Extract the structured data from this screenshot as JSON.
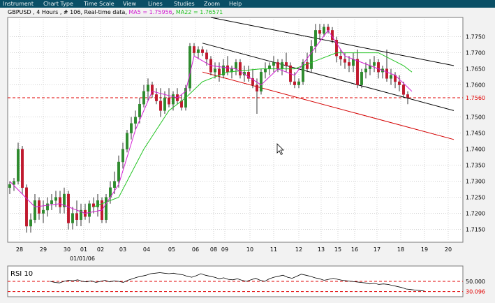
{
  "menu": [
    "Instrument",
    "Chart Type",
    "Time Scale",
    "View",
    "Lines",
    "Studies",
    "Zoom",
    "Help"
  ],
  "header": {
    "symbol_info": "GBPUSD , 4 Hours , # 106, Real-time data",
    "ma5_label": "MA5 = 1.75956",
    "ma22_label": "MA22 = 1.76571"
  },
  "colors": {
    "up_candle": "#2e8b2e",
    "down_candle": "#c0192e",
    "ma5": "#d21ed2",
    "ma22": "#22c322",
    "trend_channel": "#000000",
    "trend_red": "#d40000",
    "current_price_line": "#e10000",
    "rsi_line": "#000000",
    "rsi_level": "#e10000"
  },
  "chart_data": {
    "type": "candlestick",
    "title": "GBPUSD , 4 Hours , # 106, Real-time data",
    "y_range": [
      1.711,
      1.781
    ],
    "y_ticks": [
      "1.7750",
      "1.7700",
      "1.7650",
      "1.7600",
      "1.7500",
      "1.7450",
      "1.7400",
      "1.7350",
      "1.7300",
      "1.7250",
      "1.7200",
      "1.7150"
    ],
    "current_price": "1.7560",
    "x_ticks": [
      "28",
      "29",
      "30",
      "01",
      "02",
      "03",
      "04",
      "05",
      "06",
      "08",
      "09",
      "10",
      "11",
      "12",
      "13",
      "15",
      "16",
      "17",
      "18",
      "19",
      "20"
    ],
    "x_sublabel": "01/01/06",
    "candles": [
      [
        1.728,
        1.73,
        1.726,
        1.729
      ],
      [
        1.729,
        1.731,
        1.727,
        1.73
      ],
      [
        1.73,
        1.742,
        1.729,
        1.74
      ],
      [
        1.74,
        1.741,
        1.726,
        1.728
      ],
      [
        1.728,
        1.729,
        1.714,
        1.716
      ],
      [
        1.716,
        1.72,
        1.714,
        1.718
      ],
      [
        1.718,
        1.726,
        1.717,
        1.724
      ],
      [
        1.724,
        1.725,
        1.718,
        1.72
      ],
      [
        1.72,
        1.724,
        1.717,
        1.721
      ],
      [
        1.721,
        1.725,
        1.719,
        1.723
      ],
      [
        1.723,
        1.726,
        1.721,
        1.724
      ],
      [
        1.724,
        1.727,
        1.722,
        1.725
      ],
      [
        1.725,
        1.727,
        1.72,
        1.722
      ],
      [
        1.722,
        1.728,
        1.72,
        1.726
      ],
      [
        1.726,
        1.727,
        1.715,
        1.717
      ],
      [
        1.717,
        1.722,
        1.715,
        1.72
      ],
      [
        1.72,
        1.724,
        1.716,
        1.718
      ],
      [
        1.718,
        1.723,
        1.716,
        1.721
      ],
      [
        1.721,
        1.723,
        1.718,
        1.719
      ],
      [
        1.719,
        1.724,
        1.717,
        1.723
      ],
      [
        1.723,
        1.725,
        1.72,
        1.722
      ],
      [
        1.722,
        1.726,
        1.719,
        1.724
      ],
      [
        1.724,
        1.725,
        1.717,
        1.718
      ],
      [
        1.718,
        1.726,
        1.717,
        1.725
      ],
      [
        1.725,
        1.73,
        1.723,
        1.728
      ],
      [
        1.728,
        1.733,
        1.726,
        1.73
      ],
      [
        1.73,
        1.738,
        1.728,
        1.736
      ],
      [
        1.736,
        1.742,
        1.734,
        1.74
      ],
      [
        1.74,
        1.746,
        1.739,
        1.745
      ],
      [
        1.745,
        1.75,
        1.743,
        1.748
      ],
      [
        1.748,
        1.752,
        1.746,
        1.75
      ],
      [
        1.75,
        1.756,
        1.748,
        1.754
      ],
      [
        1.754,
        1.76,
        1.753,
        1.758
      ],
      [
        1.758,
        1.762,
        1.755,
        1.76
      ],
      [
        1.76,
        1.761,
        1.756,
        1.757
      ],
      [
        1.757,
        1.759,
        1.754,
        1.755
      ],
      [
        1.755,
        1.759,
        1.75,
        1.752
      ],
      [
        1.752,
        1.758,
        1.751,
        1.756
      ],
      [
        1.756,
        1.759,
        1.753,
        1.754
      ],
      [
        1.754,
        1.758,
        1.752,
        1.757
      ],
      [
        1.757,
        1.759,
        1.754,
        1.755
      ],
      [
        1.755,
        1.757,
        1.752,
        1.753
      ],
      [
        1.753,
        1.76,
        1.752,
        1.759
      ],
      [
        1.759,
        1.773,
        1.758,
        1.772
      ],
      [
        1.772,
        1.773,
        1.769,
        1.77
      ],
      [
        1.77,
        1.772,
        1.768,
        1.771
      ],
      [
        1.771,
        1.772,
        1.769,
        1.77
      ],
      [
        1.77,
        1.771,
        1.766,
        1.768
      ],
      [
        1.768,
        1.769,
        1.763,
        1.764
      ],
      [
        1.764,
        1.767,
        1.762,
        1.765
      ],
      [
        1.765,
        1.767,
        1.761,
        1.763
      ],
      [
        1.763,
        1.768,
        1.762,
        1.766
      ],
      [
        1.766,
        1.769,
        1.763,
        1.764
      ],
      [
        1.764,
        1.766,
        1.762,
        1.765
      ],
      [
        1.765,
        1.768,
        1.763,
        1.767
      ],
      [
        1.767,
        1.768,
        1.762,
        1.763
      ],
      [
        1.763,
        1.766,
        1.761,
        1.764
      ],
      [
        1.764,
        1.766,
        1.761,
        1.762
      ],
      [
        1.762,
        1.765,
        1.759,
        1.76
      ],
      [
        1.76,
        1.762,
        1.751,
        1.758
      ],
      [
        1.758,
        1.765,
        1.757,
        1.764
      ],
      [
        1.764,
        1.767,
        1.762,
        1.765
      ],
      [
        1.765,
        1.767,
        1.763,
        1.766
      ],
      [
        1.766,
        1.769,
        1.764,
        1.767
      ],
      [
        1.767,
        1.768,
        1.764,
        1.765
      ],
      [
        1.765,
        1.768,
        1.763,
        1.767
      ],
      [
        1.767,
        1.77,
        1.764,
        1.766
      ],
      [
        1.766,
        1.767,
        1.76,
        1.761
      ],
      [
        1.761,
        1.764,
        1.759,
        1.76
      ],
      [
        1.76,
        1.762,
        1.759,
        1.761
      ],
      [
        1.761,
        1.768,
        1.76,
        1.767
      ],
      [
        1.767,
        1.77,
        1.764,
        1.765
      ],
      [
        1.765,
        1.774,
        1.764,
        1.772
      ],
      [
        1.772,
        1.779,
        1.77,
        1.777
      ],
      [
        1.777,
        1.779,
        1.774,
        1.776
      ],
      [
        1.776,
        1.779,
        1.775,
        1.778
      ],
      [
        1.778,
        1.779,
        1.776,
        1.777
      ],
      [
        1.777,
        1.778,
        1.773,
        1.774
      ],
      [
        1.774,
        1.775,
        1.767,
        1.769
      ],
      [
        1.769,
        1.771,
        1.766,
        1.768
      ],
      [
        1.768,
        1.77,
        1.765,
        1.767
      ],
      [
        1.767,
        1.769,
        1.764,
        1.766
      ],
      [
        1.766,
        1.77,
        1.764,
        1.768
      ],
      [
        1.768,
        1.771,
        1.759,
        1.76
      ],
      [
        1.76,
        1.765,
        1.759,
        1.764
      ],
      [
        1.764,
        1.767,
        1.762,
        1.765
      ],
      [
        1.765,
        1.768,
        1.763,
        1.766
      ],
      [
        1.766,
        1.769,
        1.764,
        1.767
      ],
      [
        1.767,
        1.768,
        1.762,
        1.764
      ],
      [
        1.764,
        1.766,
        1.762,
        1.765
      ],
      [
        1.765,
        1.771,
        1.761,
        1.762
      ],
      [
        1.762,
        1.765,
        1.76,
        1.763
      ],
      [
        1.763,
        1.764,
        1.759,
        1.761
      ],
      [
        1.761,
        1.763,
        1.758,
        1.76
      ],
      [
        1.76,
        1.761,
        1.756,
        1.757
      ],
      [
        1.757,
        1.758,
        1.754,
        1.756
      ]
    ],
    "ma5": [
      [
        0,
        1.73
      ],
      [
        6,
        1.722
      ],
      [
        12,
        1.723
      ],
      [
        18,
        1.72
      ],
      [
        22,
        1.721
      ],
      [
        26,
        1.729
      ],
      [
        30,
        1.746
      ],
      [
        34,
        1.758
      ],
      [
        40,
        1.756
      ],
      [
        42,
        1.758
      ],
      [
        44,
        1.769
      ],
      [
        48,
        1.766
      ],
      [
        54,
        1.765
      ],
      [
        60,
        1.76
      ],
      [
        64,
        1.765
      ],
      [
        68,
        1.763
      ],
      [
        72,
        1.77
      ],
      [
        76,
        1.777
      ],
      [
        80,
        1.769
      ],
      [
        86,
        1.766
      ],
      [
        92,
        1.763
      ],
      [
        96,
        1.758
      ]
    ],
    "ma22": [
      [
        20,
        1.722
      ],
      [
        26,
        1.725
      ],
      [
        32,
        1.74
      ],
      [
        38,
        1.752
      ],
      [
        42,
        1.756
      ],
      [
        46,
        1.761
      ],
      [
        52,
        1.764
      ],
      [
        60,
        1.765
      ],
      [
        68,
        1.765
      ],
      [
        74,
        1.768
      ],
      [
        78,
        1.77
      ],
      [
        82,
        1.77
      ],
      [
        88,
        1.77
      ],
      [
        94,
        1.766
      ],
      [
        96,
        1.764
      ]
    ],
    "trend_lines": [
      {
        "name": "upper-channel",
        "color": "trend_channel",
        "points": [
          [
            48,
            1.781
          ],
          [
            106,
            1.766
          ]
        ]
      },
      {
        "name": "lower-channel",
        "color": "trend_channel",
        "points": [
          [
            46,
            1.773
          ],
          [
            106,
            1.752
          ]
        ]
      },
      {
        "name": "red-trend",
        "color": "trend_red",
        "points": [
          [
            46,
            1.764
          ],
          [
            106,
            1.743
          ]
        ]
      }
    ],
    "rsi": {
      "title": "RSI 10",
      "levels": [
        "50.000",
        "30.096"
      ],
      "range": [
        20,
        80
      ],
      "values": [
        50,
        48,
        47,
        50,
        52,
        51,
        53,
        50,
        49,
        51,
        48,
        50,
        52,
        49,
        51,
        50,
        48,
        52,
        55,
        58,
        60,
        62,
        65,
        66,
        67,
        66,
        65,
        66,
        64,
        63,
        60,
        58,
        61,
        65,
        62,
        60,
        58,
        55,
        57,
        54,
        53,
        55,
        52,
        50,
        53,
        56,
        52,
        50,
        55,
        58,
        60,
        62,
        58,
        56,
        60,
        64,
        62,
        60,
        57,
        55,
        52,
        54,
        56,
        54,
        52,
        51,
        50,
        49,
        48,
        47,
        45,
        46,
        44,
        45,
        44,
        42,
        40,
        38,
        35,
        34,
        33,
        32,
        31
      ]
    }
  }
}
